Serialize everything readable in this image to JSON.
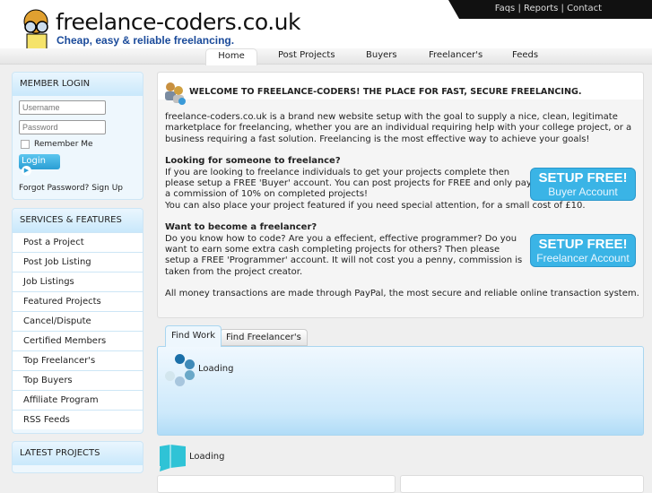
{
  "header": {
    "site_title": "freelance-coders.co.uk",
    "tagline": "Cheap, easy & reliable freelancing.",
    "top_links": [
      "Faqs",
      "Reports",
      "Contact"
    ]
  },
  "nav": {
    "items": [
      "Home",
      "Post Projects",
      "Buyers",
      "Freelancer's",
      "Feeds"
    ],
    "active": "Home"
  },
  "login": {
    "title": "MEMBER LOGIN",
    "username_placeholder": "Username",
    "password_placeholder": "Password",
    "remember": "Remember Me",
    "button": "Login",
    "forgot": "Forgot Password?",
    "signup": "Sign Up"
  },
  "services": {
    "title": "SERVICES & FEATURES",
    "items": [
      "Post a Project",
      "Post Job Listing",
      "Job Listings",
      "Featured Projects",
      "Cancel/Dispute",
      "Certified Members",
      "Top Freelancer's",
      "Top Buyers",
      "Affiliate Program",
      "RSS Feeds"
    ]
  },
  "latest": {
    "title": "LATEST PROJECTS"
  },
  "main": {
    "title": "WELCOME TO FREELANCE-CODERS! THE PLACE FOR FAST, SECURE FREELANCING.",
    "intro": "freelance-coders.co.uk is a brand new website setup with the goal to supply a nice, clean, legitimate marketplace for freelancing, whether you are an individual requiring help with your college project, or a business requiring a fast solution. Freelancing is the most effective way to achieve your goals!",
    "buyer_heading": "Looking for someone to freelance?",
    "buyer_text": "If you are looking to freelance individuals to get your projects complete then please setup a FREE 'Buyer' account. You can post projects for FREE and only pay a commission of 10% on completed projects!",
    "buyer_text2": "You can also place your project featured if you need special attention, for a small cost of £10.",
    "freelancer_heading": "Want to become a freelancer?",
    "freelancer_text": "Do you know how to code? Are you a effecient, effective programmer? Do you want to earn some extra cash completing projects for others? Then please setup a FREE 'Programmer' account. It will not cost you a penny, commission is taken from the project creator.",
    "paypal": "All money transactions are made through PayPal, the most secure and reliable online transaction system.",
    "buyer_btn": {
      "top": "SETUP FREE!",
      "bottom": "Buyer Account"
    },
    "freelancer_btn": {
      "top": "SETUP FREE!",
      "bottom": "Freelancer Account"
    }
  },
  "tabs": {
    "items": [
      "Find Work",
      "Find Freelancer's"
    ],
    "active": "Find Work",
    "loading": "Loading"
  },
  "feed": {
    "loading": "Loading"
  }
}
